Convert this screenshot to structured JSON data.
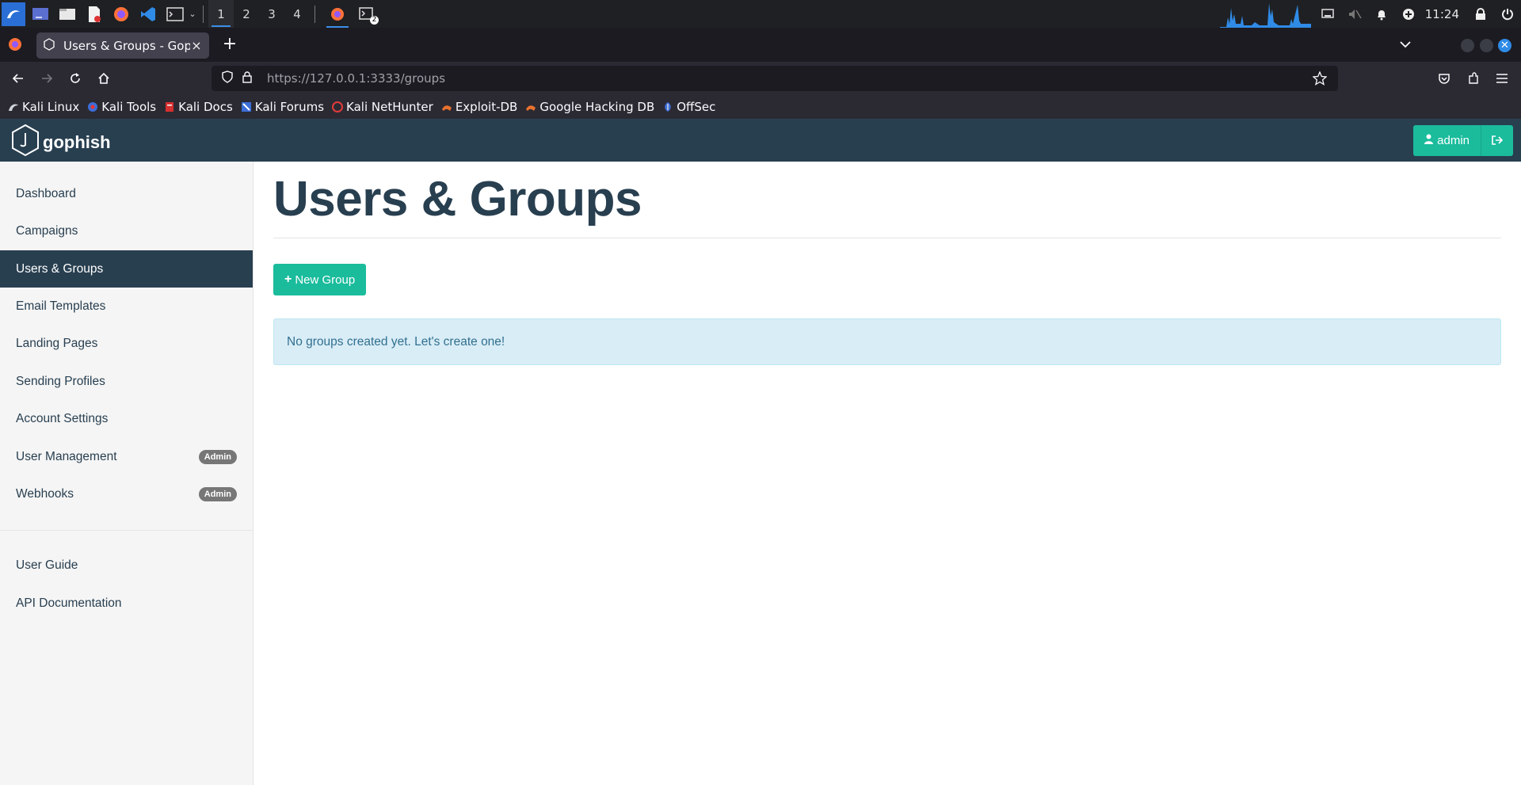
{
  "os_taskbar": {
    "workspaces": [
      "1",
      "2",
      "3",
      "4"
    ],
    "active_workspace": "1",
    "clock": "11:24",
    "terminal_badge": "2"
  },
  "browser": {
    "tab": {
      "title": "Users & Groups - Gophish"
    },
    "url": {
      "host": "https://127.0.0.1",
      "rest": ":3333/groups"
    },
    "bookmarks": [
      {
        "label": "Kali Linux",
        "icon": "kali-dragon-icon"
      },
      {
        "label": "Kali Tools",
        "icon": "kali-tools-icon"
      },
      {
        "label": "Kali Docs",
        "icon": "kali-docs-icon"
      },
      {
        "label": "Kali Forums",
        "icon": "kali-forums-icon"
      },
      {
        "label": "Kali NetHunter",
        "icon": "nethunter-icon"
      },
      {
        "label": "Exploit-DB",
        "icon": "exploit-db-icon"
      },
      {
        "label": "Google Hacking DB",
        "icon": "ghdb-icon"
      },
      {
        "label": "OffSec",
        "icon": "offsec-icon"
      }
    ]
  },
  "app": {
    "brand": "gophish",
    "user_button": "admin",
    "sidebar": {
      "items": [
        {
          "label": "Dashboard"
        },
        {
          "label": "Campaigns"
        },
        {
          "label": "Users & Groups",
          "active": true
        },
        {
          "label": "Email Templates"
        },
        {
          "label": "Landing Pages"
        },
        {
          "label": "Sending Profiles"
        },
        {
          "label": "Account Settings"
        },
        {
          "label": "User Management",
          "badge": "Admin"
        },
        {
          "label": "Webhooks",
          "badge": "Admin"
        }
      ],
      "secondary": [
        {
          "label": "User Guide"
        },
        {
          "label": "API Documentation"
        }
      ]
    },
    "main": {
      "title": "Users & Groups",
      "new_group_label": "New Group",
      "empty_message": "No groups created yet. Let's create one!"
    },
    "colors": {
      "header_bg": "#283f50",
      "accent": "#1abc9c",
      "info_bg": "#d9edf7",
      "info_text": "#31708f"
    }
  }
}
